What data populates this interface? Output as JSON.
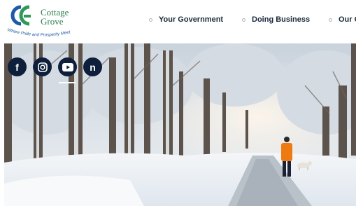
{
  "header": {
    "logo": {
      "name_line1": "Cottage",
      "name_line2": "Grove",
      "tagline": "Where Pride and Prosperity Meet"
    }
  },
  "nav": {
    "items": [
      {
        "label": "Your Government"
      },
      {
        "label": "Doing Business"
      },
      {
        "label": "Our C"
      }
    ]
  },
  "social": {
    "items": [
      {
        "icon": "facebook-icon",
        "glyph": "f"
      },
      {
        "icon": "instagram-icon",
        "glyph": ""
      },
      {
        "icon": "youtube-icon",
        "glyph": ""
      },
      {
        "icon": "nextdoor-icon",
        "glyph": "n"
      }
    ]
  },
  "colors": {
    "brand_green": "#2e7d4f",
    "brand_blue": "#1e5aa8",
    "social_bg": "#0d1f3a",
    "nav_text": "#1a2a3a",
    "walker_jacket": "#f07a12"
  }
}
